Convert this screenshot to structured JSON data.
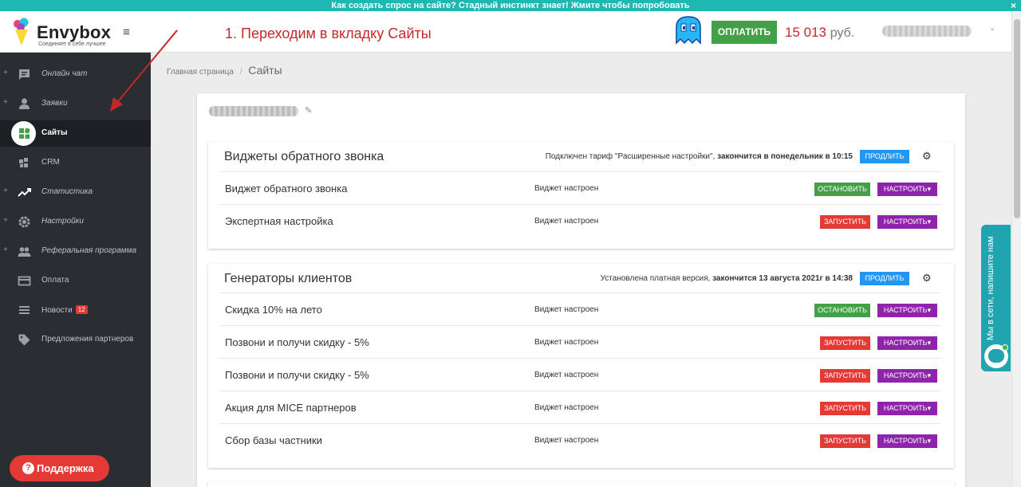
{
  "banner": {
    "text": "Как создать спрос на сайте? Стадный инстинкт знает! Жмите чтобы попробовать",
    "close": "×"
  },
  "header": {
    "logo_name": "Envybox",
    "logo_tagline": "Соединяет в себе лучшее",
    "menu_icon": "≡",
    "annotation": "1. Переходим в вкладку Сайты",
    "pay_label": "ОПЛАТИТЬ",
    "balance": "15 013",
    "currency": "руб.",
    "chevron": "⌄"
  },
  "sidebar": {
    "items": [
      {
        "label": "Онлайн чат",
        "icon": "chat-icon",
        "expandable": true
      },
      {
        "label": "Заявки",
        "icon": "person-icon",
        "expandable": true
      },
      {
        "label": "Сайты",
        "icon": "sites-icon",
        "expandable": false,
        "active": true
      },
      {
        "label": "CRM",
        "icon": "crm-icon",
        "expandable": false
      },
      {
        "label": "Статистика",
        "icon": "chart-icon",
        "expandable": true
      },
      {
        "label": "Настройки",
        "icon": "gear-icon",
        "expandable": true
      },
      {
        "label": "Реферальная программа",
        "icon": "people-icon",
        "expandable": true
      },
      {
        "label": "Оплата",
        "icon": "card-icon",
        "expandable": false
      },
      {
        "label": "Новости",
        "icon": "news-icon",
        "expandable": false,
        "badge": "12"
      },
      {
        "label": "Предложения партнеров",
        "icon": "tag-icon",
        "expandable": false
      }
    ],
    "plus": "+",
    "support_label": "Поддержка",
    "support_icon": "?"
  },
  "breadcrumb": {
    "home": "Главная страница",
    "separator": "/",
    "current": "Сайты"
  },
  "site": {
    "edit_icon": "✎"
  },
  "panels": [
    {
      "title": "Виджеты обратного звонка",
      "info_prefix": "Подключен тариф \"Расширенные настройки\", ",
      "info_bold": "закончится в понедельник в 10:15",
      "extend_label": "ПРОДЛИТЬ",
      "rows": [
        {
          "name": "Виджет обратного звонка",
          "status": "Виджет настроен",
          "action": "ОСТАНОВИТЬ",
          "action_type": "stop",
          "config": "НАСТРОИТЬ▾"
        },
        {
          "name": "Экспертная настройка",
          "status": "Виджет настроен",
          "action": "ЗАПУСТИТЬ",
          "action_type": "start",
          "config": "НАСТРОИТЬ▾"
        }
      ]
    },
    {
      "title": "Генераторы клиентов",
      "info_prefix": "Установлена платная версия, ",
      "info_bold": "закончится 13 августа 2021г в 14:38",
      "extend_label": "ПРОДЛИТЬ",
      "rows": [
        {
          "name": "Скидка 10% на лето",
          "status": "Виджет настроен",
          "action": "ОСТАНОВИТЬ",
          "action_type": "stop",
          "config": "НАСТРОИТЬ▾"
        },
        {
          "name": "Позвони и получи скидку - 5%",
          "status": "Виджет настроен",
          "action": "ЗАПУСТИТЬ",
          "action_type": "start",
          "config": "НАСТРОИТЬ▾"
        },
        {
          "name": "Позвони и получи скидку - 5%",
          "status": "Виджет настроен",
          "action": "ЗАПУСТИТЬ",
          "action_type": "start",
          "config": "НАСТРОИТЬ▾"
        },
        {
          "name": "Акция для MICE партнеров",
          "status": "Виджет настроен",
          "action": "ЗАПУСТИТЬ",
          "action_type": "start",
          "config": "НАСТРОИТЬ▾"
        },
        {
          "name": "Сбор базы частники",
          "status": "Виджет настроен",
          "action": "ЗАПУСТИТЬ",
          "action_type": "start",
          "config": "НАСТРОИТЬ▾"
        }
      ]
    }
  ],
  "gear_glyph": "⚙",
  "chat_widget": {
    "text": "Мы в сети, напишите нам"
  },
  "colors": {
    "banner": "#1fb7b1",
    "sidebar": "#2a2e33",
    "pay": "#43a047",
    "balance": "#c62828",
    "extend": "#2196f3",
    "stop": "#43a047",
    "start": "#e53935",
    "config": "#8e24aa",
    "support": "#e53935",
    "chat": "#1fa4b0"
  }
}
